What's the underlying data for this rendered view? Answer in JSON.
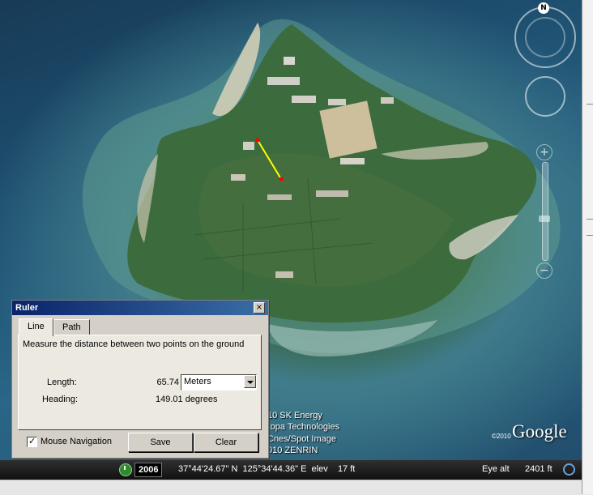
{
  "map": {
    "compass_north": "N",
    "attribution_lines": [
      "10 SK Energy",
      "ropa Technologies",
      "Cnes/Spot Image",
      "010 ZENRIN"
    ],
    "google_logo": "Google",
    "google_copyright": "©2010",
    "measure_line_color": "#ffff00",
    "measure_endpoint_color": "#ff0000"
  },
  "status_bar": {
    "imagery_date": "2006",
    "coordinates": "37°44'24.67\" N  125°34'44.36\" E  elev    17 ft",
    "eye_alt_label": "Eye alt",
    "eye_alt_value": "2401 ft"
  },
  "ruler": {
    "title": "Ruler",
    "tabs": [
      "Line",
      "Path"
    ],
    "active_tab": "Line",
    "description": "Measure the distance between two points on the ground",
    "length_label": "Length:",
    "length_value": "65.74",
    "units_selected": "Meters",
    "heading_label": "Heading:",
    "heading_value": "149.01 degrees",
    "mouse_navigation_label": "Mouse Navigation",
    "mouse_navigation_checked": true,
    "save_label": "Save",
    "clear_label": "Clear",
    "title_bar_color": "#0a246a"
  }
}
